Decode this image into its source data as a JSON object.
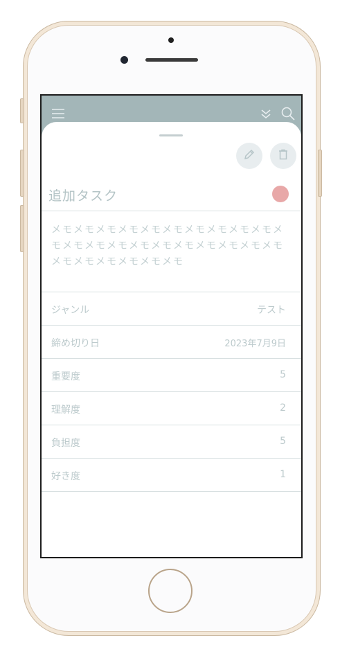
{
  "task": {
    "title": "追加タスク",
    "memo": "メモメモメモメモメモメモメモメモメモメモメモメモメモメモメモメモメモメモメモメモメモメモメモメモメモメモメモ",
    "status_color": "#e8a8a8"
  },
  "fields": [
    {
      "label": "ジャンル",
      "value": "テスト"
    },
    {
      "label": "締め切り日",
      "value": "2023年7月9日"
    },
    {
      "label": "重要度",
      "value": "5"
    },
    {
      "label": "理解度",
      "value": "2"
    },
    {
      "label": "負担度",
      "value": "5"
    },
    {
      "label": "好き度",
      "value": "1"
    }
  ],
  "icons": {
    "menu": "menu-icon",
    "collapse": "double-chevron-down-icon",
    "search": "search-icon",
    "edit": "pencil-icon",
    "delete": "trash-icon"
  },
  "colors": {
    "topbar": "#a3b6b8",
    "text_muted": "#bccacc",
    "accent_dot": "#e8a8a8"
  }
}
